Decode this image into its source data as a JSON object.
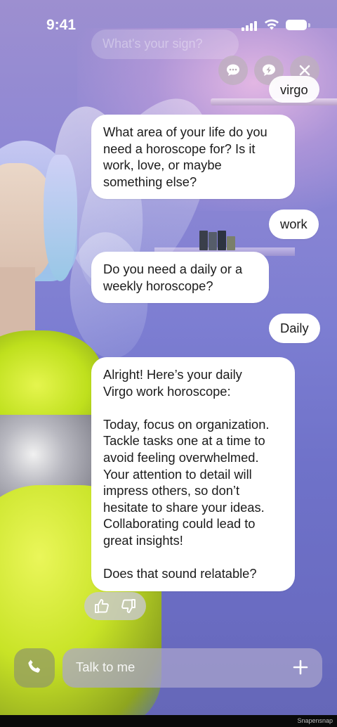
{
  "status_bar": {
    "time": "9:41"
  },
  "ghost_message": "What's your sign?",
  "top_buttons": [
    {
      "icon": "chat-bubble-icon"
    },
    {
      "icon": "lightning-bubble-icon"
    },
    {
      "icon": "close-icon"
    }
  ],
  "messages": [
    {
      "role": "user",
      "text": "virgo"
    },
    {
      "role": "bot",
      "text": "What area of your life do you\nneed a horoscope for? Is it\nwork, love, or maybe\nsomething else?"
    },
    {
      "role": "user",
      "text": "work"
    },
    {
      "role": "bot",
      "text": "Do you need a daily or a\nweekly horoscope?"
    },
    {
      "role": "user",
      "text": "Daily"
    },
    {
      "role": "bot",
      "text": "Alright! Here’s your daily\nVirgo work horoscope:\n\nToday, focus on organization.\nTackle tasks one at a time to\navoid feeling overwhelmed.\nYour attention to detail will\nimpress others, so don’t\nhesitate to share your ideas.\nCollaborating could lead to\ngreat insights!\n\nDoes that sound relatable?"
    }
  ],
  "feedback": {
    "like_icon": "thumbs-up-icon",
    "dislike_icon": "thumbs-down-icon"
  },
  "composer": {
    "placeholder": "Talk to me",
    "call_icon": "phone-icon",
    "add_icon": "plus-icon"
  },
  "watermark": "Snapensnap"
}
